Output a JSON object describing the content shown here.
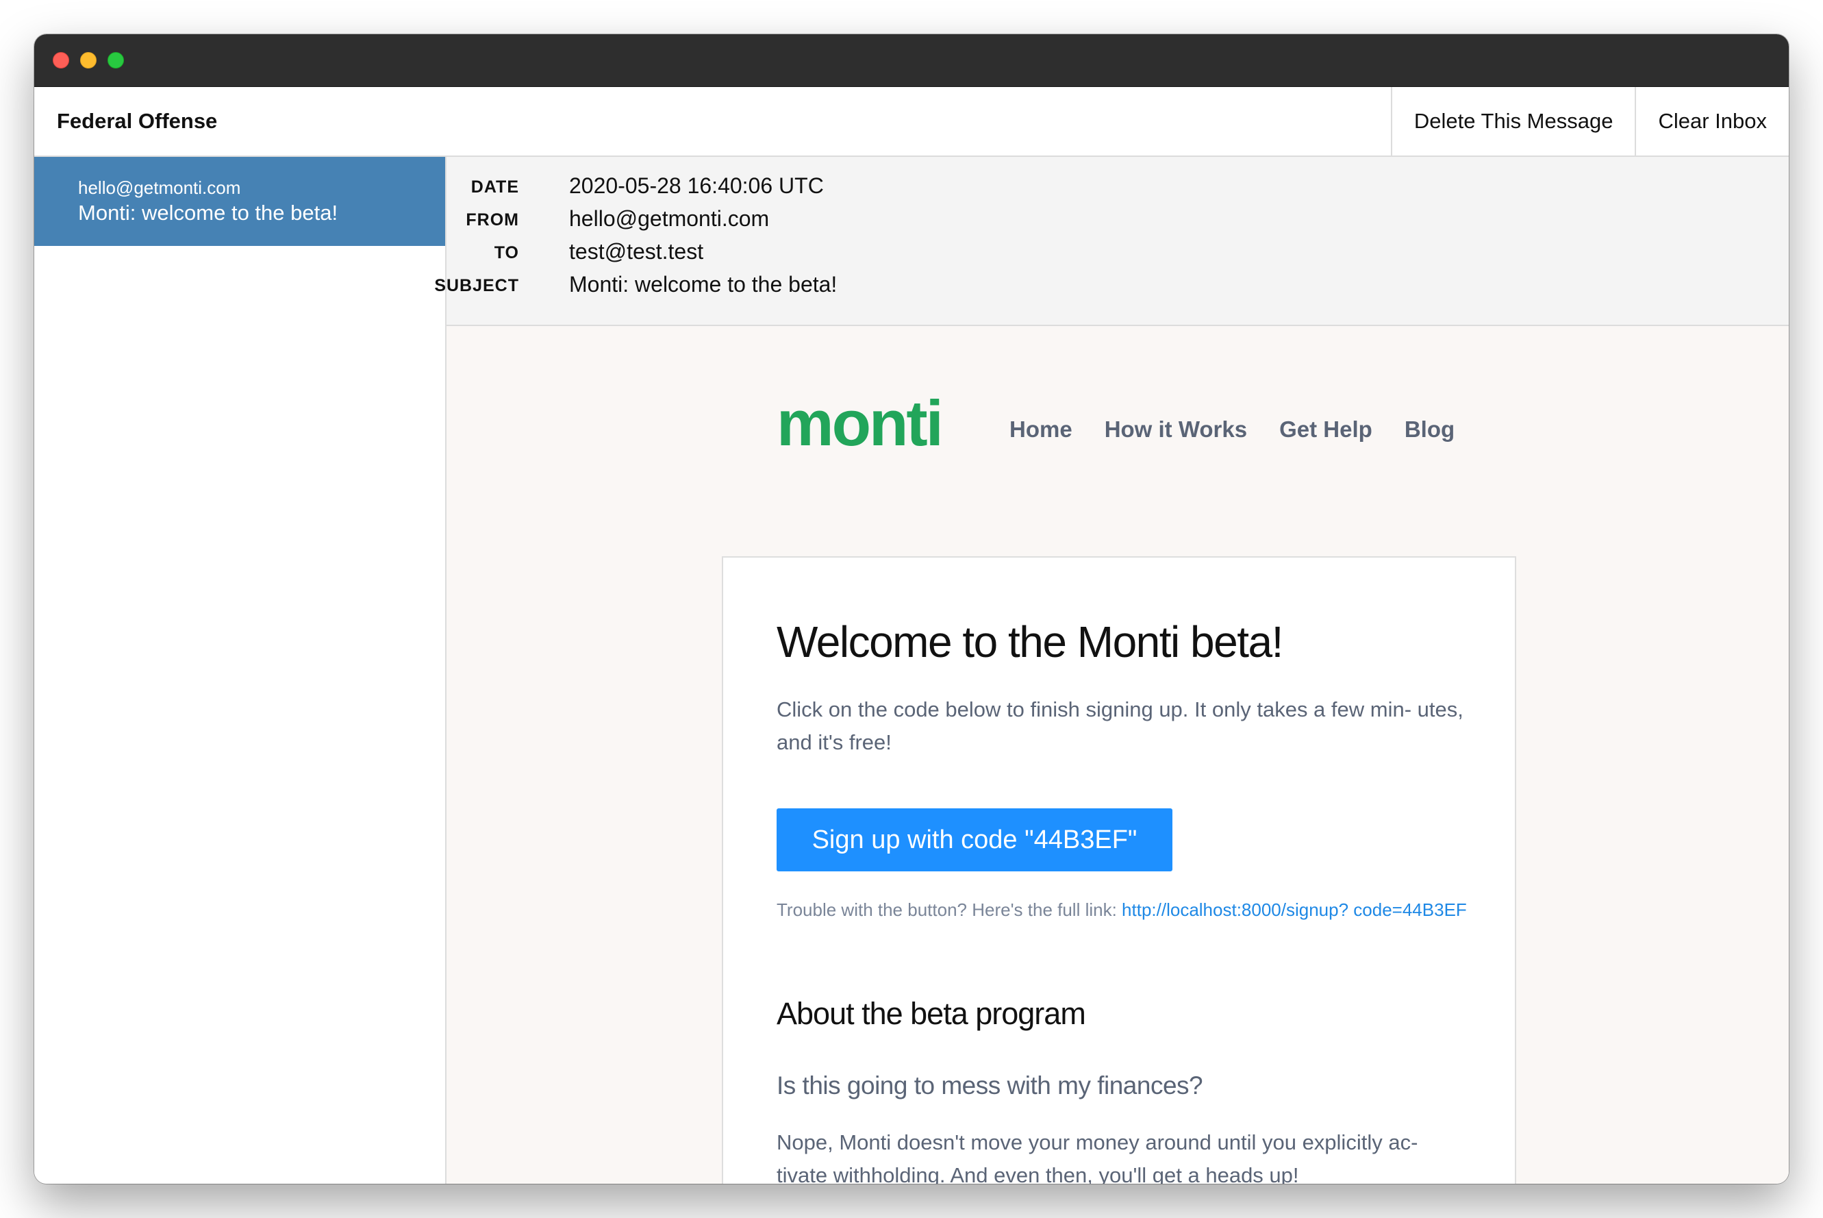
{
  "app": {
    "title": "Federal Offense"
  },
  "actions": {
    "delete_label": "Delete This Message",
    "clear_label": "Clear Inbox"
  },
  "inbox": {
    "items": [
      {
        "from": "hello@getmonti.com",
        "subject": "Monti: welcome to the beta!",
        "selected": true
      }
    ]
  },
  "message": {
    "headers": {
      "date_label": "DATE",
      "date": "2020-05-28 16:40:06 UTC",
      "from_label": "FROM",
      "from": "hello@getmonti.com",
      "to_label": "TO",
      "to": "test@test.test",
      "subject_label": "SUBJECT",
      "subject": "Monti: welcome to the beta!"
    },
    "email": {
      "brand": "monti",
      "brand_color": "#22a55a",
      "nav": [
        "Home",
        "How it Works",
        "Get Help",
        "Blog"
      ],
      "title": "Welcome to the Monti beta!",
      "intro": "Click on the code below to finish signing up. It only takes a few min- utes, and it's free!",
      "button_label": "Sign up with code \"44B3EF\"",
      "button_color": "#1e90ff",
      "fallback_text": "Trouble with the button? Here's the full link: ",
      "fallback_link": "http://localhost:8000/signup? code=44B3EF",
      "section_title": "About the beta program",
      "question": "Is this going to mess with my finances?",
      "answer": "Nope, Monti doesn't move your money around until you explicitly ac- tivate withholding. And even then, you'll get a heads up!"
    }
  },
  "colors": {
    "selected_item_bg": "#4682b4",
    "header_bg": "#f4f4f4",
    "email_bg": "#faf7f5"
  }
}
